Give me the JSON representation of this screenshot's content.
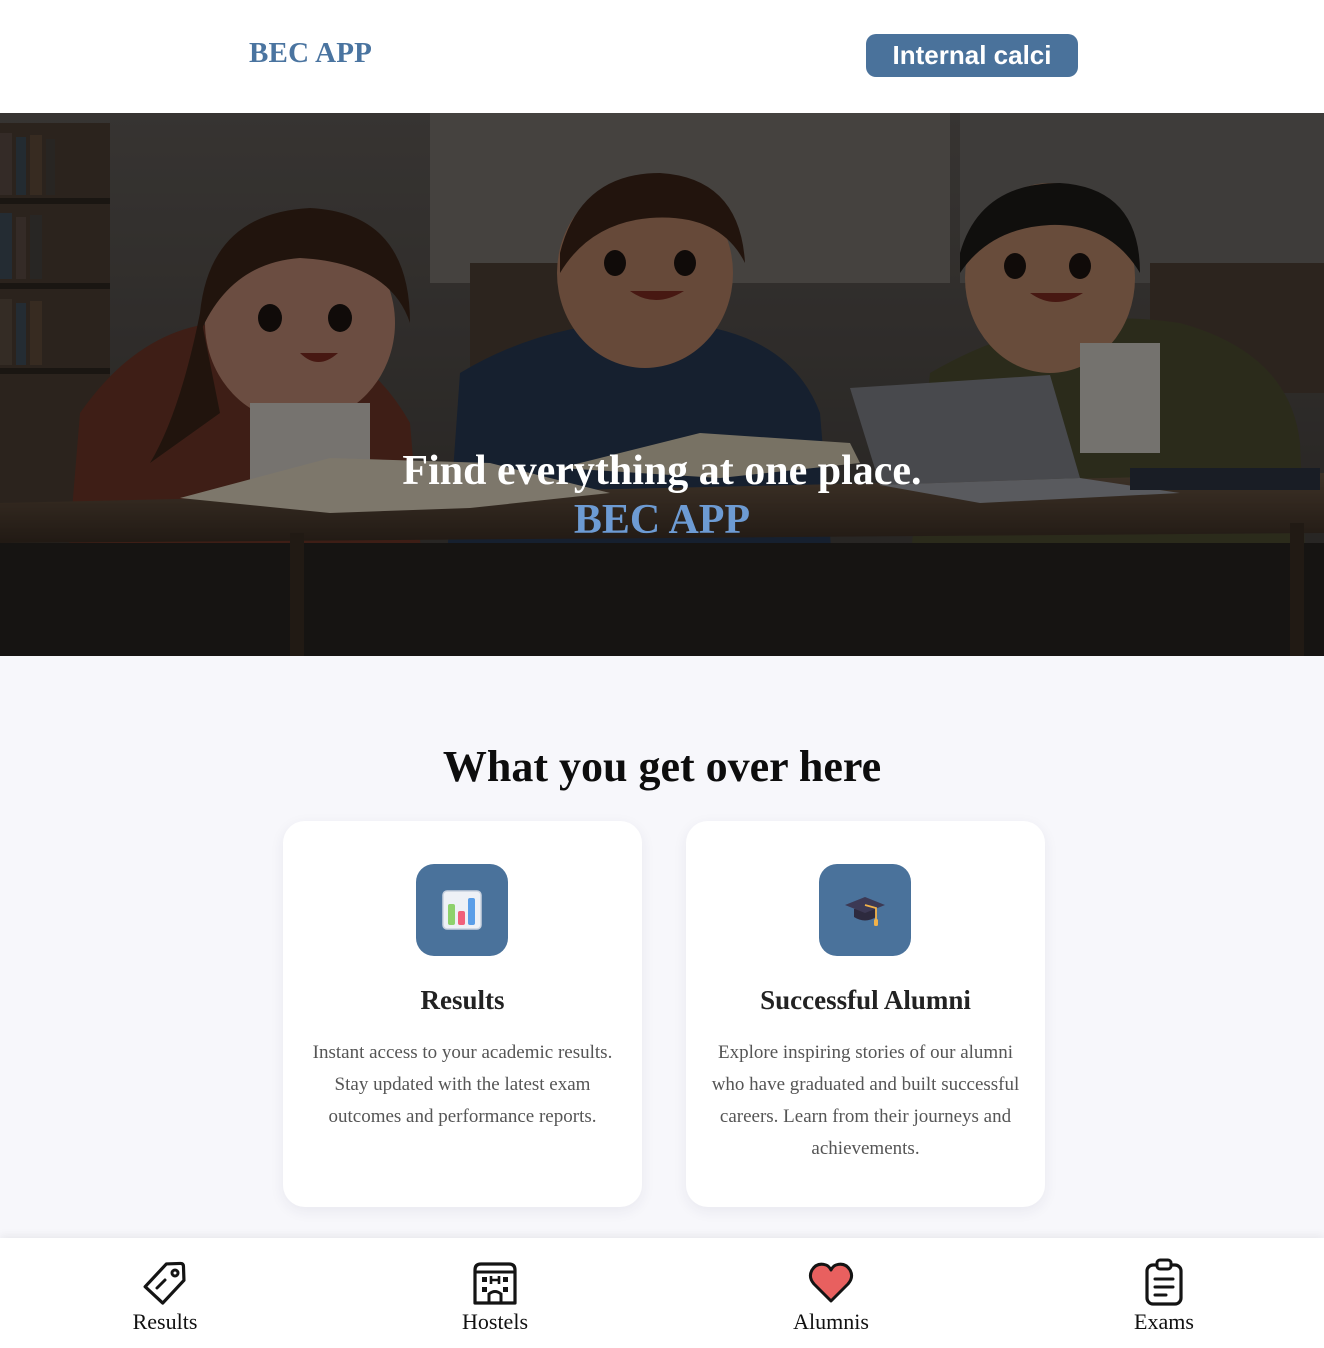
{
  "header": {
    "brand": "BEC APP",
    "calci_button": "Internal calci"
  },
  "hero": {
    "title": "Find everything at one place.",
    "subtitle": "BEC APP"
  },
  "features": {
    "heading": "What you get over here",
    "cards": [
      {
        "icon": "bar-chart-icon",
        "title": "Results",
        "text": "Instant access to your academic results. Stay updated with the latest exam outcomes and performance reports."
      },
      {
        "icon": "graduation-cap-icon",
        "title": "Successful Alumni",
        "text": "Explore inspiring stories of our alumni who have graduated and built successful careers. Learn from their journeys and achievements."
      }
    ]
  },
  "bottom_nav": {
    "items": [
      {
        "label": "Results",
        "icon": "tag-icon"
      },
      {
        "label": "Hostels",
        "icon": "building-icon"
      },
      {
        "label": "Alumnis",
        "icon": "heart-icon"
      },
      {
        "label": "Exams",
        "icon": "clipboard-icon"
      }
    ]
  },
  "colors": {
    "brand": "#4a74a0",
    "button": "#4a729b",
    "hero_accent": "#6d9bd3",
    "heart": "#e8605f"
  }
}
